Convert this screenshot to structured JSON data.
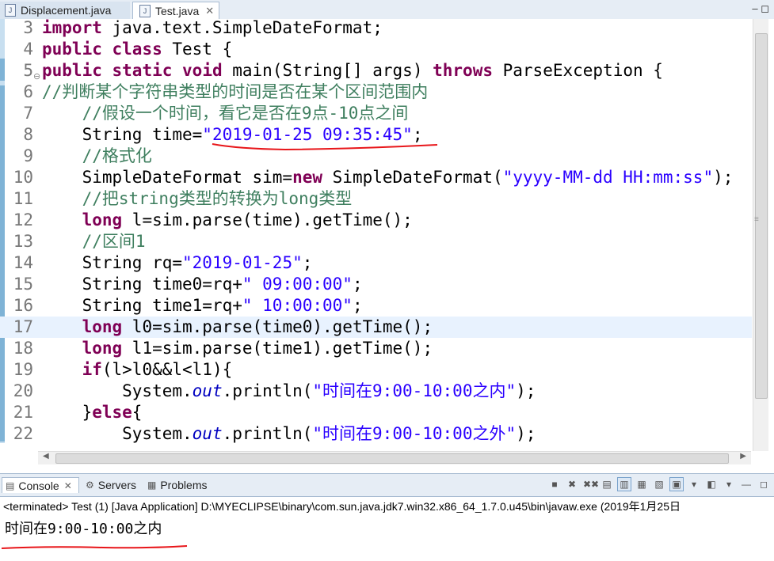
{
  "editor_tabs": [
    {
      "label": "Displacement.java",
      "close": ""
    },
    {
      "label": "Test.java",
      "close": "✕"
    }
  ],
  "window_controls": "–  ◻",
  "code_lines": [
    {
      "num": "3",
      "tokens": [
        {
          "t": "import",
          "c": "kw"
        },
        {
          "t": " java.text.SimpleDateFormat;"
        }
      ]
    },
    {
      "num": "4",
      "tokens": [
        {
          "t": "public",
          "c": "kw"
        },
        {
          "t": " "
        },
        {
          "t": "class",
          "c": "kw"
        },
        {
          "t": " Test {"
        }
      ]
    },
    {
      "num": "5",
      "fold": "⊖",
      "tokens": [
        {
          "t": "public",
          "c": "kw"
        },
        {
          "t": " "
        },
        {
          "t": "static",
          "c": "kw"
        },
        {
          "t": " "
        },
        {
          "t": "void",
          "c": "kw"
        },
        {
          "t": " main(String[] args) "
        },
        {
          "t": "throws",
          "c": "kw"
        },
        {
          "t": " ParseException {"
        }
      ]
    },
    {
      "num": "6",
      "tokens": [
        {
          "t": "//判断某个字符串类型的时间是否在某个区间范围内",
          "c": "cm"
        }
      ]
    },
    {
      "num": "7",
      "tokens": [
        {
          "t": "    "
        },
        {
          "t": "//假设一个时间，看它是否在9点-10点之间",
          "c": "cm"
        }
      ]
    },
    {
      "num": "8",
      "tokens": [
        {
          "t": "    String time="
        },
        {
          "t": "\"2019-01-25 09:35:45\"",
          "c": "str"
        },
        {
          "t": ";"
        }
      ]
    },
    {
      "num": "9",
      "tokens": [
        {
          "t": "    "
        },
        {
          "t": "//格式化",
          "c": "cm"
        }
      ]
    },
    {
      "num": "10",
      "tokens": [
        {
          "t": "    SimpleDateFormat sim="
        },
        {
          "t": "new",
          "c": "kw"
        },
        {
          "t": " SimpleDateFormat("
        },
        {
          "t": "\"yyyy-MM-dd HH:mm:ss\"",
          "c": "str"
        },
        {
          "t": ");"
        }
      ]
    },
    {
      "num": "11",
      "tokens": [
        {
          "t": "    "
        },
        {
          "t": "//把string类型的转换为long类型",
          "c": "cm"
        }
      ]
    },
    {
      "num": "12",
      "tokens": [
        {
          "t": "    "
        },
        {
          "t": "long",
          "c": "kw"
        },
        {
          "t": " l=sim.parse(time).getTime();"
        }
      ]
    },
    {
      "num": "13",
      "tokens": [
        {
          "t": "    "
        },
        {
          "t": "//区间1",
          "c": "cm"
        }
      ]
    },
    {
      "num": "14",
      "tokens": [
        {
          "t": "    String rq="
        },
        {
          "t": "\"2019-01-25\"",
          "c": "str"
        },
        {
          "t": ";"
        }
      ]
    },
    {
      "num": "15",
      "tokens": [
        {
          "t": "    String time0=rq+"
        },
        {
          "t": "\" 09:00:00\"",
          "c": "str"
        },
        {
          "t": ";"
        }
      ]
    },
    {
      "num": "16",
      "tokens": [
        {
          "t": "    String time1=rq+"
        },
        {
          "t": "\" 10:00:00\"",
          "c": "str"
        },
        {
          "t": ";"
        }
      ]
    },
    {
      "num": "17",
      "current": true,
      "tokens": [
        {
          "t": "    "
        },
        {
          "t": "long",
          "c": "kw"
        },
        {
          "t": " l0=sim.parse(time0).getTime();"
        }
      ]
    },
    {
      "num": "18",
      "tokens": [
        {
          "t": "    "
        },
        {
          "t": "long",
          "c": "kw"
        },
        {
          "t": " l1=sim.parse(time1).getTime();"
        }
      ]
    },
    {
      "num": "19",
      "tokens": [
        {
          "t": "    "
        },
        {
          "t": "if",
          "c": "kw"
        },
        {
          "t": "(l>l0&&l<l1){"
        }
      ]
    },
    {
      "num": "20",
      "tokens": [
        {
          "t": "        System."
        },
        {
          "t": "out",
          "c": "fld"
        },
        {
          "t": ".println("
        },
        {
          "t": "\"时间在9:00-10:00之内\"",
          "c": "str"
        },
        {
          "t": ");"
        }
      ]
    },
    {
      "num": "21",
      "tokens": [
        {
          "t": "    }"
        },
        {
          "t": "else",
          "c": "kw"
        },
        {
          "t": "{"
        }
      ]
    },
    {
      "num": "22",
      "tokens": [
        {
          "t": "        System."
        },
        {
          "t": "out",
          "c": "fld"
        },
        {
          "t": ".println("
        },
        {
          "t": "\"时间在9:00-10:00之外\"",
          "c": "str"
        },
        {
          "t": ");"
        }
      ]
    }
  ],
  "console_tabs": [
    {
      "label": "Console",
      "icon": "console-icon",
      "close": "✕"
    },
    {
      "label": "Servers",
      "icon": "servers-icon"
    },
    {
      "label": "Problems",
      "icon": "problems-icon"
    }
  ],
  "console_toolbar": [
    "■",
    "✖",
    "✖✖",
    "▤",
    "▥",
    "▦",
    "▧",
    "▣",
    "▾",
    "◧",
    "▾",
    "—",
    "◻"
  ],
  "terminated_text": "<terminated> Test (1) [Java Application] D:\\MYECLIPSE\\binary\\com.sun.java.jdk7.win32.x86_64_1.7.0.u45\\bin\\javaw.exe (2019年1月25日",
  "output": {
    "prefix": "时间在",
    "mono": "9:00-10:00",
    "suffix": "之内"
  },
  "colors": {
    "keyword": "#7f0055",
    "string": "#2a00ff",
    "comment": "#3f7f5f",
    "field": "#0000c0",
    "annotation": "#e8161a"
  }
}
